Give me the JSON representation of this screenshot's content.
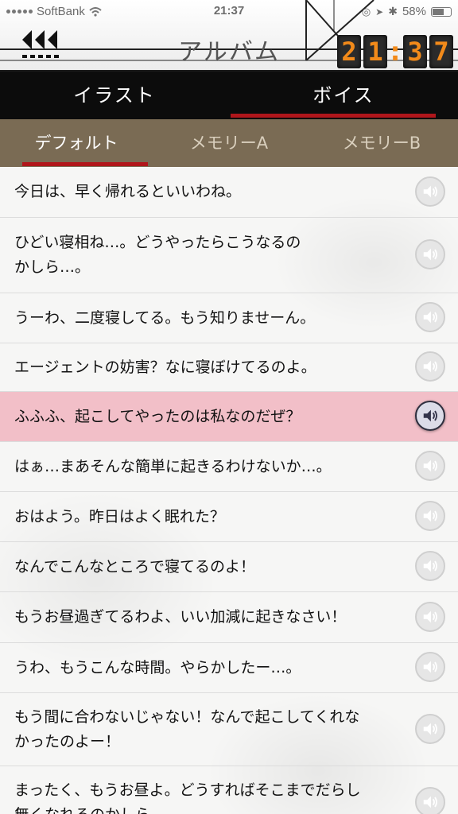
{
  "status_bar": {
    "carrier": "SoftBank",
    "time": "21:37",
    "battery": "58%",
    "battery_level": 0.58
  },
  "header": {
    "title": "アルバム",
    "clock_digits": [
      "2",
      "1",
      "3",
      "7"
    ],
    "clock_separator": ":"
  },
  "tabs": [
    {
      "label": "イラスト",
      "active": false
    },
    {
      "label": "ボイス",
      "active": true
    }
  ],
  "subtabs": [
    {
      "label": "デフォルト",
      "active": true
    },
    {
      "label": "メモリーA",
      "active": false
    },
    {
      "label": "メモリーB",
      "active": false
    }
  ],
  "voices": [
    {
      "text": "今日は、早く帰れるといいわね。",
      "selected": false
    },
    {
      "text": "ひどい寝相ね…。どうやったらこうなるの\nかしら…。",
      "selected": false
    },
    {
      "text": "うーわ、二度寝してる。もう知りませーん。",
      "selected": false
    },
    {
      "text": "エージェントの妨害？なに寝ぼけてるのよ。",
      "selected": false
    },
    {
      "text": "ふふふ、起こしてやったのは私なのだぜ？",
      "selected": true
    },
    {
      "text": "はぁ…まあそんな簡単に起きるわけないか…。",
      "selected": false
    },
    {
      "text": "おはよう。昨日はよく眠れた？",
      "selected": false
    },
    {
      "text": "なんでこんなところで寝てるのよ！",
      "selected": false
    },
    {
      "text": "もうお昼過ぎてるわよ、いい加減に起きなさい！",
      "selected": false
    },
    {
      "text": "うわ、もうこんな時間。やらかしたー…。",
      "selected": false
    },
    {
      "text": "もう間に合わないじゃない！なんで起こしてくれな\nかったのよー！",
      "selected": false
    },
    {
      "text": "まったく、もうお昼よ。どうすればそこまでだらし\n無くなれるのかしら",
      "selected": false
    }
  ],
  "colors": {
    "accent_red": "#b0161b",
    "subtab_bg": "#7a6b54",
    "selected_row": "#f2bfc8",
    "clock_digit": "#f28a1a"
  }
}
